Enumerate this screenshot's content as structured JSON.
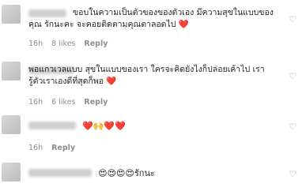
{
  "comments": [
    {
      "text": "ขอบในความเป็นตัวของของตัวเอง มีความสุขในแบบของ\nคุณ รักนะคะ จะคอยติดตามคุณตาลอดไป ❤️",
      "time": "16h",
      "likes": "8 likes",
      "reply": "Reply"
    },
    {
      "text": "พอแกวเวลแบบ สุขในแบบของเรา ใครจะคิดยังไงก็ปล่อยเค้าไป เรา\nรู้ตัวเราเองดีที่สุดก็พอ ❤️",
      "time": "16h",
      "likes": "6 likes",
      "reply": "Reply"
    },
    {
      "text": "❤️🙌❤️❤️",
      "time": "16h",
      "reply": "Reply"
    },
    {
      "text": "😍😍😍😍รักนะ"
    }
  ],
  "icons": {
    "like": "heart-outline-icon"
  }
}
